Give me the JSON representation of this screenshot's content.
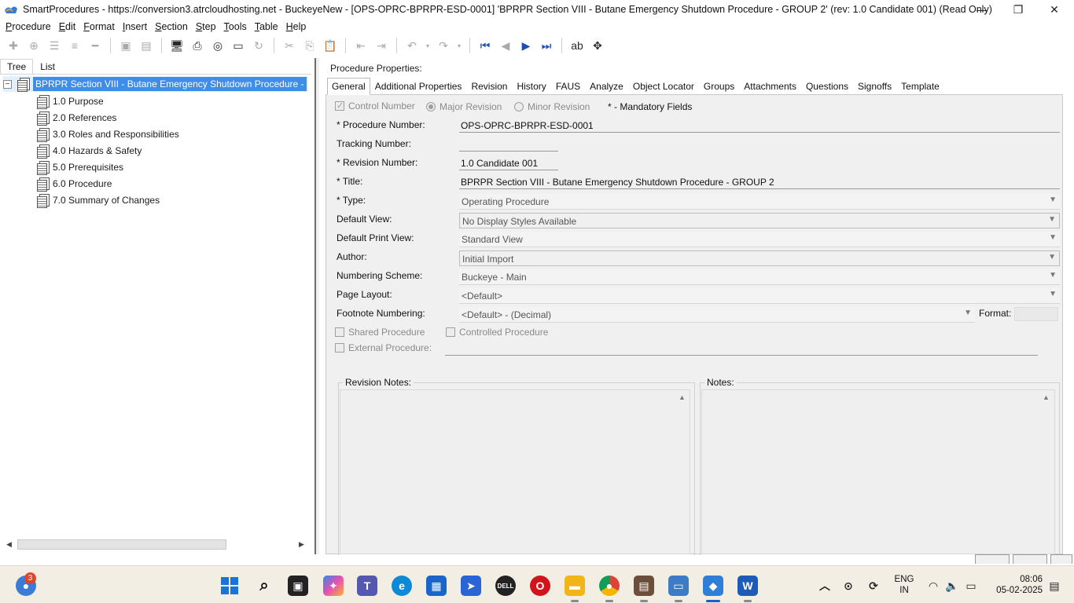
{
  "window": {
    "title": "SmartProcedures - https://conversion3.atrcloudhosting.net - BuckeyeNew - [OPS-OPRC-BPRPR-ESD-0001] 'BPRPR Section VIII - Butane Emergency Shutdown Procedure - GROUP 2' (rev: 1.0 Candidate 001) (Read Only)",
    "minimize": "—",
    "restore": "❐",
    "close": "✕"
  },
  "menu": [
    "Procedure",
    "Edit",
    "Format",
    "Insert",
    "Section",
    "Step",
    "Tools",
    "Table",
    "Help"
  ],
  "left_tabs": [
    "Tree",
    "List"
  ],
  "tree": {
    "root": "BPRPR Section VIII - Butane Emergency Shutdown Procedure - G...",
    "expander": "−",
    "children": [
      "1.0 Purpose",
      "2.0 References",
      "3.0 Roles and Responsibilities",
      "4.0 Hazards & Safety",
      "5.0 Prerequisites",
      "6.0 Procedure",
      "7.0 Summary of Changes"
    ]
  },
  "properties": {
    "header": "Procedure Properties:",
    "tabs": [
      "General",
      "Additional Properties",
      "Revision",
      "History",
      "FAUS",
      "Analyze",
      "Object Locator",
      "Groups",
      "Attachments",
      "Questions",
      "Signoffs",
      "Template"
    ],
    "control_number": "Control Number",
    "major_revision": "Major Revision",
    "minor_revision": "Minor Revision",
    "mandatory_note": "* - Mandatory Fields",
    "labels": {
      "procedure_number": "* Procedure Number:",
      "tracking_number": "Tracking Number:",
      "revision_number": "* Revision Number:",
      "title": "* Title:",
      "type": "* Type:",
      "default_view": "Default View:",
      "default_print_view": "Default Print View:",
      "author": "Author:",
      "numbering_scheme": "Numbering Scheme:",
      "page_layout": "Page Layout:",
      "footnote_numbering": "Footnote Numbering:",
      "format": "Format:"
    },
    "values": {
      "procedure_number": "OPS-OPRC-BPRPR-ESD-0001",
      "tracking_number": "",
      "revision_number": "1.0 Candidate 001",
      "title": "BPRPR Section VIII - Butane Emergency Shutdown Procedure - GROUP 2",
      "type": "Operating Procedure",
      "default_view": "No Display Styles Available",
      "default_print_view": "Standard View",
      "author": "Initial Import",
      "numbering_scheme": "Buckeye - Main",
      "page_layout": "<Default>",
      "footnote_numbering": "<Default> - (Decimal)",
      "format": ""
    },
    "shared_procedure": "Shared Procedure",
    "controlled_procedure": "Controlled Procedure",
    "external_procedure": "External Procedure:",
    "revision_notes": "Revision Notes:",
    "notes": "Notes:"
  },
  "taskbar": {
    "notification_count": "3",
    "language": "ENG",
    "region": "IN",
    "time": "08:06",
    "date": "05-02-2025"
  }
}
